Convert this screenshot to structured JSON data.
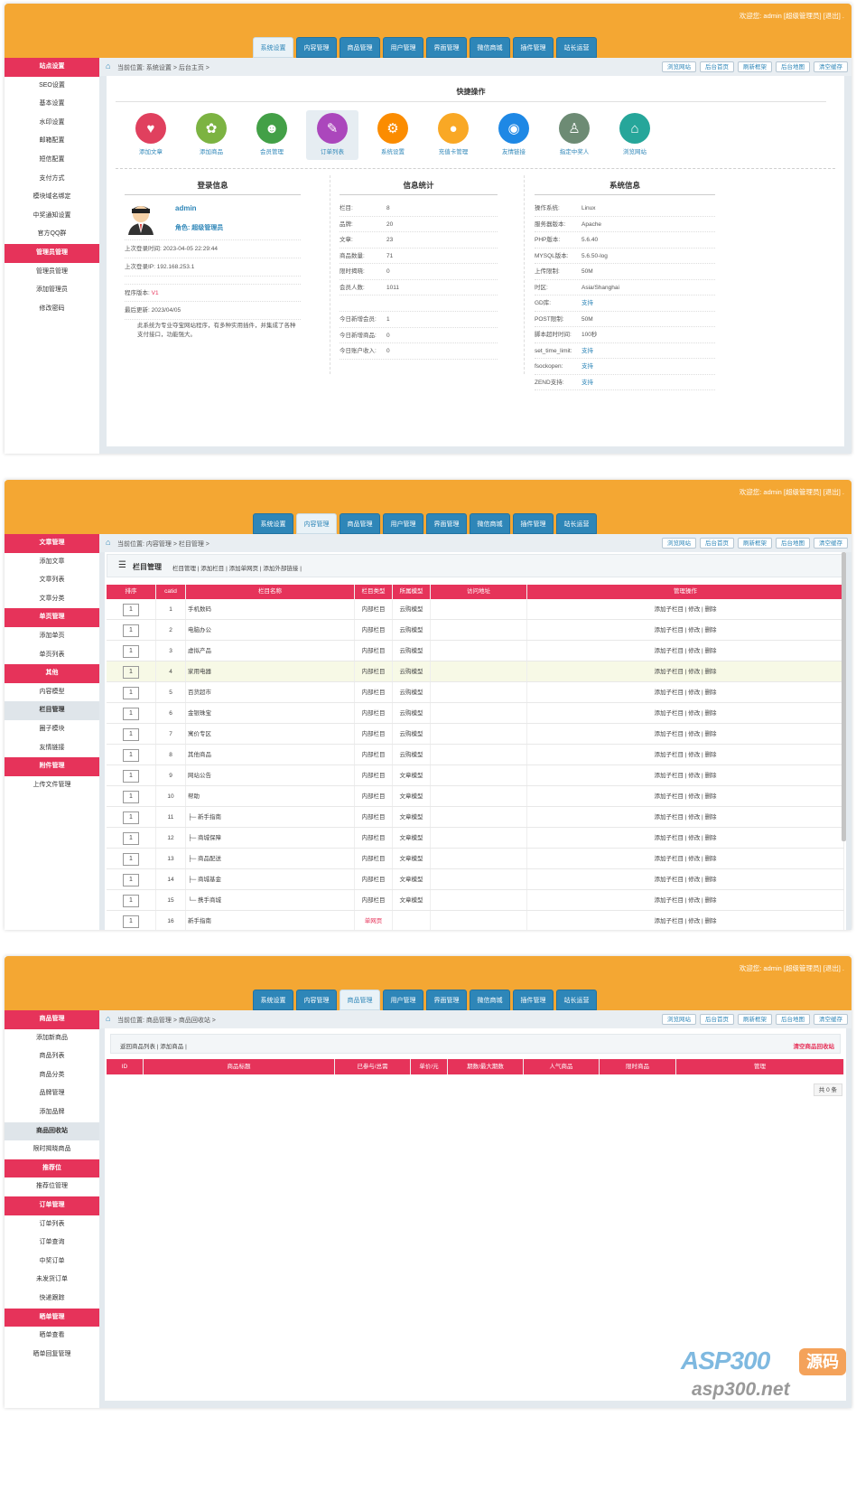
{
  "shots": [
    {
      "welcome": "欢迎您:  admin [超级管理员]  [退出] .",
      "tabs": [
        "系统设置",
        "内容管理",
        "商品管理",
        "用户管理",
        "界面管理",
        "微信商城",
        "插件管理",
        "站长运营"
      ],
      "active_tab": 0,
      "sidebar": [
        {
          "label": "站点设置",
          "type": "header"
        },
        {
          "label": "SEO设置"
        },
        {
          "label": "基本设置"
        },
        {
          "label": "水印设置"
        },
        {
          "label": "邮箱配置"
        },
        {
          "label": "短信配置"
        },
        {
          "label": "支付方式"
        },
        {
          "label": "模块域名绑定"
        },
        {
          "label": "中奖通知设置"
        },
        {
          "label": "官方QQ群"
        },
        {
          "label": "管理员管理",
          "type": "header"
        },
        {
          "label": "管理员管理"
        },
        {
          "label": "添加管理员"
        },
        {
          "label": "修改密码"
        }
      ],
      "breadcrumb": "当前位置: 系统设置 > 后台主页 >",
      "header_buttons": [
        "浏览网站",
        "后台首页",
        "刷新框架",
        "后台地图",
        "清空缓存"
      ]
    },
    {
      "welcome": "欢迎您:  admin [超级管理员]  [退出] .",
      "tabs": [
        "系统设置",
        "内容管理",
        "商品管理",
        "用户管理",
        "界面管理",
        "微信商城",
        "插件管理",
        "站长运营"
      ],
      "active_tab": 1,
      "sidebar": [
        {
          "label": "文章管理",
          "type": "header"
        },
        {
          "label": "添加文章"
        },
        {
          "label": "文章列表"
        },
        {
          "label": "文章分类"
        },
        {
          "label": "单页管理",
          "type": "header"
        },
        {
          "label": "添加单页"
        },
        {
          "label": "单页列表"
        },
        {
          "label": "其他",
          "type": "header"
        },
        {
          "label": "内容模型"
        },
        {
          "label": "栏目管理",
          "type": "current"
        },
        {
          "label": "圈子模块"
        },
        {
          "label": "友情链接"
        },
        {
          "label": "附件管理",
          "type": "header"
        },
        {
          "label": "上传文件管理"
        }
      ],
      "breadcrumb": "当前位置: 内容管理 > 栏目管理 >",
      "header_buttons": [
        "浏览网站",
        "后台首页",
        "刷新框架",
        "后台地图",
        "清空缓存"
      ]
    },
    {
      "welcome": "欢迎您:  admin [超级管理员]  [退出] .",
      "tabs": [
        "系统设置",
        "内容管理",
        "商品管理",
        "用户管理",
        "界面管理",
        "微信商城",
        "插件管理",
        "站长运营"
      ],
      "active_tab": 2,
      "sidebar": [
        {
          "label": "商品管理",
          "type": "header"
        },
        {
          "label": "添加新商品"
        },
        {
          "label": "商品列表"
        },
        {
          "label": "商品分类"
        },
        {
          "label": "品牌管理"
        },
        {
          "label": "添加品牌"
        },
        {
          "label": "商品回收站",
          "type": "current"
        },
        {
          "label": "限时揭晓商品"
        },
        {
          "label": "推荐位",
          "type": "header"
        },
        {
          "label": "推荐位管理"
        },
        {
          "label": "订单管理",
          "type": "header"
        },
        {
          "label": "订单列表"
        },
        {
          "label": "订单查询"
        },
        {
          "label": "中奖订单"
        },
        {
          "label": "未发货订单"
        },
        {
          "label": "快递跟踪"
        },
        {
          "label": "晒单管理",
          "type": "header"
        },
        {
          "label": "晒单查看"
        },
        {
          "label": "晒单回复管理"
        }
      ],
      "breadcrumb": "当前位置: 商品管理 > 商品回收站 >",
      "header_buttons": [
        "浏览网站",
        "后台首页",
        "刷新框架",
        "后台地图",
        "清空缓存"
      ]
    }
  ],
  "dashboard": {
    "quick_title": "快捷操作",
    "quick_items": [
      {
        "label": "添加文章",
        "color": "#e0405e",
        "glyph": "♥"
      },
      {
        "label": "添加商品",
        "color": "#7cb342",
        "glyph": "✿"
      },
      {
        "label": "会员管理",
        "color": "#43a047",
        "glyph": "☻"
      },
      {
        "label": "订单列表",
        "color": "#ab47bc",
        "glyph": "✎",
        "selected": true
      },
      {
        "label": "系统设置",
        "color": "#fb8c00",
        "glyph": "⚙"
      },
      {
        "label": "充值卡管理",
        "color": "#f9a825",
        "glyph": "●"
      },
      {
        "label": "友情链接",
        "color": "#1e88e5",
        "glyph": "◉"
      },
      {
        "label": "指定中奖人",
        "color": "#6d8b74",
        "glyph": "♙"
      },
      {
        "label": "浏览网站",
        "color": "#26a69a",
        "glyph": "⌂"
      }
    ],
    "login": {
      "title": "登录信息",
      "user": "admin",
      "role": "角色: 超级管理员",
      "last_time": "上次登录时间: 2023-04-05 22:29:44",
      "last_ip": "上次登录IP: 192.168.253.1",
      "version_label": "程序版本: ",
      "version": "V1",
      "updated": "最后更新: 2023/04/05",
      "desc": "此系统为专业夺宝网站程序，有多种实用插件，并集成了各种支付接口，功能强大。"
    },
    "stats": {
      "title": "信息统计",
      "rows": [
        [
          "栏目:",
          "8"
        ],
        [
          "品牌:",
          "20"
        ],
        [
          "文章:",
          "23"
        ],
        [
          "商品数量:",
          "71"
        ],
        [
          "限时揭晓:",
          "0"
        ],
        [
          "会员人数:",
          "1011"
        ]
      ],
      "today": [
        [
          "今日新增会员:",
          "1"
        ],
        [
          "今日新增商品:",
          "0"
        ],
        [
          "今日账户收入:",
          "0"
        ]
      ]
    },
    "system": {
      "title": "系统信息",
      "rows": [
        [
          "操作系统:",
          "Linux",
          false
        ],
        [
          "服务器版本:",
          "Apache",
          false
        ],
        [
          "PHP版本:",
          "5.6.40",
          false
        ],
        [
          "MYSQL版本:",
          "5.6.50-log",
          false
        ],
        [
          "上传限制:",
          "50M",
          false
        ],
        [
          "时区:",
          "Asia/Shanghai",
          false
        ],
        [
          "GD库:",
          "支持",
          true
        ],
        [
          "POST限制:",
          "50M",
          false
        ],
        [
          "脚本超时时间:",
          "100秒",
          false
        ],
        [
          "set_time_limit:",
          "支持",
          true
        ],
        [
          "fsockopen:",
          "支持",
          true
        ],
        [
          "ZEND支持:",
          "支持",
          true
        ]
      ]
    }
  },
  "categories": {
    "toolbar_title": "栏目管理",
    "toolbar_links": "栏目管理 | 添加栏目 | 添加单网页 | 添加外部链接 |",
    "headers": [
      "排序",
      "catid",
      "栏目名称",
      "栏目类型",
      "所属模型",
      "访问地址",
      "管理操作"
    ],
    "ops": "添加子栏目 | 修改 | 删除",
    "rows": [
      [
        "1",
        "1",
        "手机数码",
        "内部栏目",
        "云购模型"
      ],
      [
        "1",
        "2",
        "电脑办公",
        "内部栏目",
        "云购模型"
      ],
      [
        "1",
        "3",
        "虚拟产品",
        "内部栏目",
        "云购模型"
      ],
      [
        "1",
        "4",
        "家用电器",
        "内部栏目",
        "云购模型"
      ],
      [
        "1",
        "5",
        "百货超市",
        "内部栏目",
        "云购模型"
      ],
      [
        "1",
        "6",
        "金银珠宝",
        "内部栏目",
        "云购模型"
      ],
      [
        "1",
        "7",
        "寓价专区",
        "内部栏目",
        "云购模型"
      ],
      [
        "1",
        "8",
        "其他商品",
        "内部栏目",
        "云购模型"
      ],
      [
        "1",
        "9",
        "网站公告",
        "内部栏目",
        "文章模型"
      ],
      [
        "1",
        "10",
        "帮助",
        "内部栏目",
        "文章模型"
      ],
      [
        "1",
        "11",
        "├─ 新手指南",
        "内部栏目",
        "文章模型"
      ],
      [
        "1",
        "12",
        "├─ 商城保障",
        "内部栏目",
        "文章模型"
      ],
      [
        "1",
        "13",
        "├─ 商品配送",
        "内部栏目",
        "文章模型"
      ],
      [
        "1",
        "14",
        "├─ 商城基金",
        "内部栏目",
        "文章模型"
      ],
      [
        "1",
        "15",
        "└─ 携手商城",
        "内部栏目",
        "文章模型"
      ],
      [
        "1",
        "16",
        "新手指南",
        "单网页",
        ""
      ]
    ]
  },
  "recycle": {
    "links": "返回商品列表 | 添加商品 |",
    "clear": "清空商品回收站",
    "headers": [
      "ID",
      "商品标题",
      "已参与/总需",
      "单价/元",
      "期数/最大期数",
      "人气商品",
      "限时商品",
      "管理"
    ],
    "count": "共 0 条"
  },
  "watermark": {
    "main": "ASP300",
    "badge": "源码",
    "url": "asp300.net"
  }
}
